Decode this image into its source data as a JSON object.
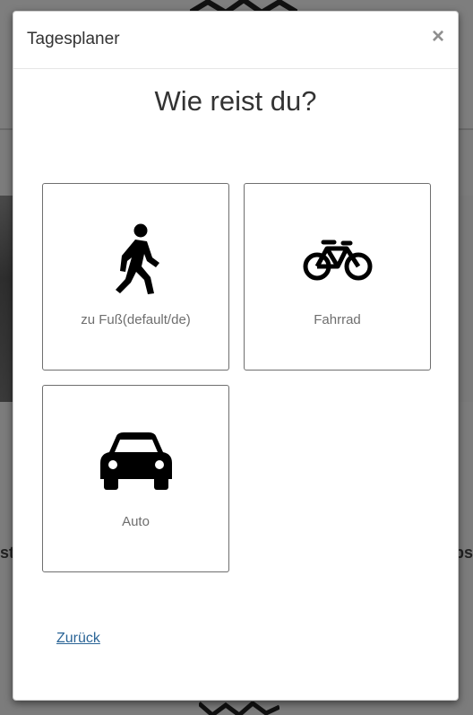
{
  "modal": {
    "title": "Tagesplaner",
    "close_label": "×",
    "question": "Wie reist du?",
    "options": [
      {
        "label": "zu Fuß(default/de)",
        "icon": "walking-person-icon"
      },
      {
        "label": "Fahrrad",
        "icon": "bicycle-icon"
      },
      {
        "label": "Auto",
        "icon": "car-icon"
      }
    ],
    "back_label": "Zurück"
  },
  "background": {
    "left_text": "st",
    "right_text": "ps"
  },
  "colors": {
    "overlay": "#7d7d7d",
    "link": "#2a6496",
    "label": "#6e6e6e"
  }
}
